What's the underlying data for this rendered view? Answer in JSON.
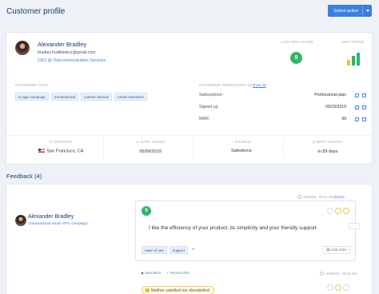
{
  "page": {
    "title": "Customer profile",
    "action_button": "Select action"
  },
  "customer": {
    "name": "Alexander Bradley",
    "email": "bradley.hodkiewicz@gmail.com",
    "company": "CEO @ Telecommunication Services",
    "last_nps_label": "LAST NPS SCORE",
    "last_nps_score": "9",
    "nps_trend_label": "NPS TREND",
    "nps_trend_bars": [
      {
        "value": 0.45,
        "color": "#f0c447"
      },
      {
        "value": 0.75,
        "color": "#2fb66a"
      },
      {
        "value": 1.0,
        "color": "#2fb66a"
      }
    ]
  },
  "tags": {
    "label": "CUSTOMER TAGS",
    "items": [
      "in-app campaign",
      "transactional",
      "custom domain",
      "email reminders"
    ]
  },
  "properties": {
    "label": "CUSTOMER PROPERTIES (8)",
    "show_all": "show all",
    "rows": [
      {
        "key": "Subscription:",
        "value": "Professional plan"
      },
      {
        "key": "Signed up:",
        "value": "09/23/2019"
      },
      {
        "key": "MRR:",
        "value": "99"
      }
    ]
  },
  "meta": [
    {
      "label": "LOCATION",
      "value": "San Francisco, CA"
    },
    {
      "label": "DATE ADDED",
      "value": "05/09/2019"
    },
    {
      "label": "SOURCE",
      "value": "Salesforce"
    },
    {
      "label": "NEXT SURVEY",
      "value": "In 89 days"
    }
  ],
  "feedback": {
    "title": "Feedback (4)",
    "author": "Alexander Bradley",
    "campaign": "Transactional email NPS campaign",
    "date": "4/4/2019 · 09:12 AM",
    "new_label": "(latest)",
    "score": "9",
    "comment": "I like the efficiency of your product, its simplicity and your friendly support.",
    "tags": [
      "ease of use",
      "support"
    ],
    "plus": "+",
    "add_note": "Add note",
    "more": "···"
  },
  "feedback2": {
    "assignee": "Alex Bitca",
    "status": "✓ RESOLVED",
    "date": "4/4/2019 · 09:12 AM",
    "neutral": "😐 Neither satisfied nor dissatisfied"
  }
}
